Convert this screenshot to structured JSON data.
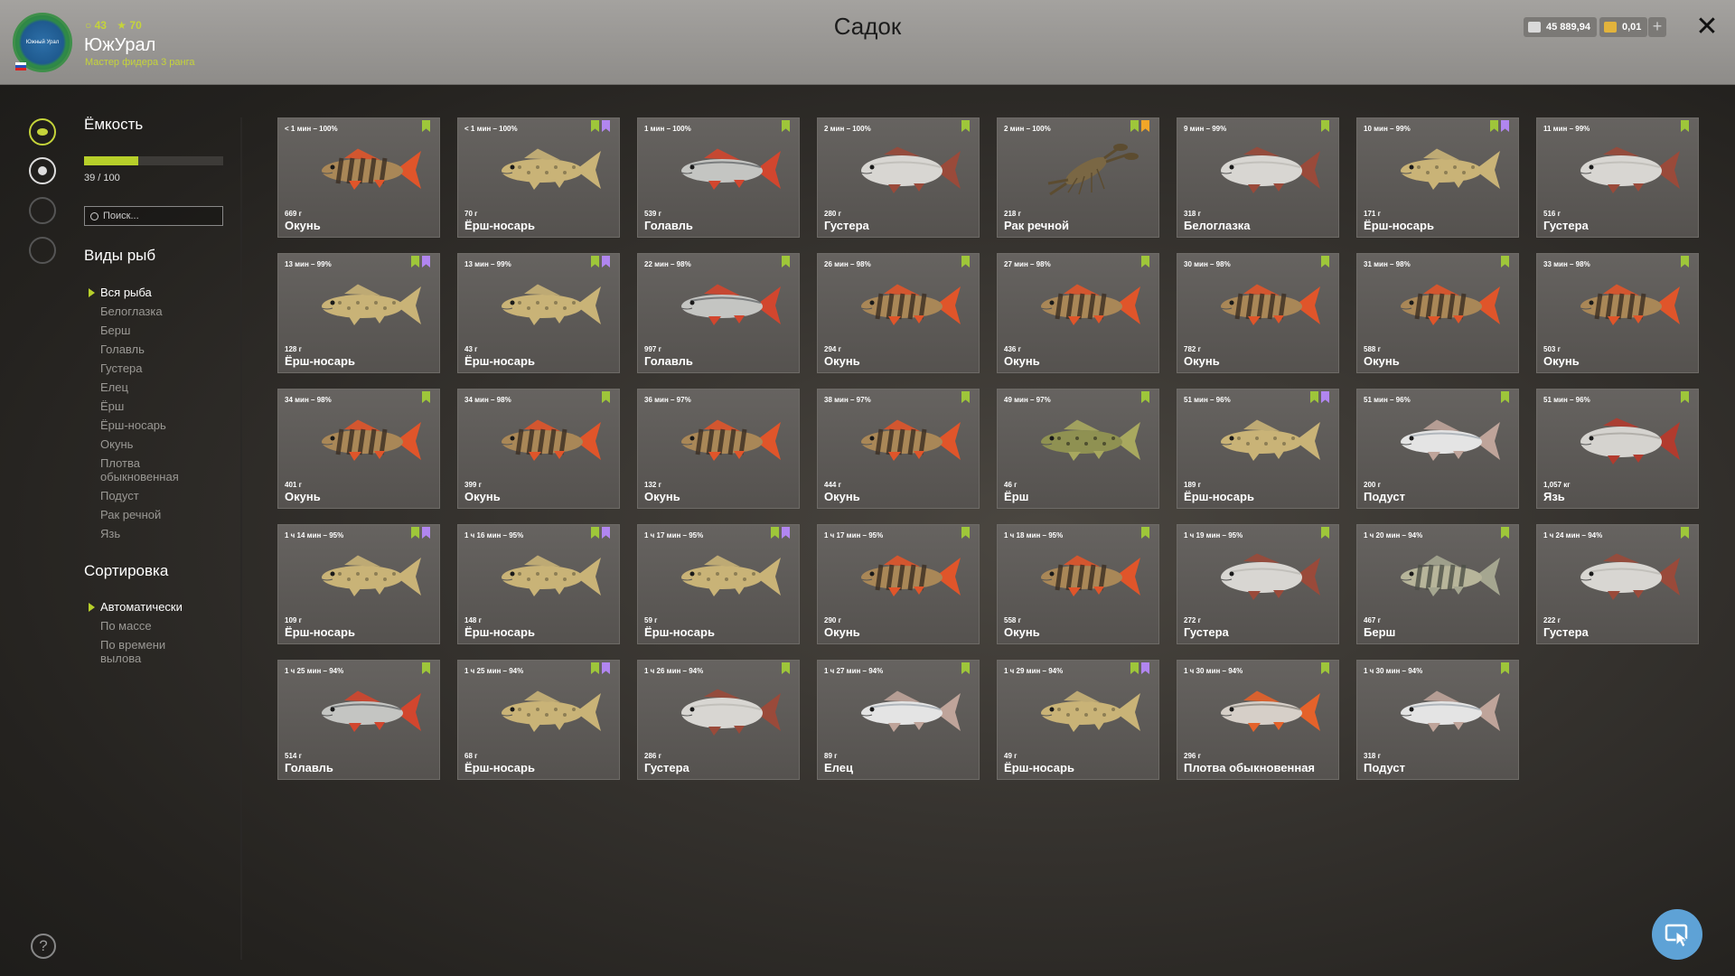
{
  "header": {
    "title": "Садок",
    "logo_text": "Южный Урал",
    "stats_a": "43",
    "stats_b": "70",
    "username": "ЮжУрал",
    "rank": "Мастер фидера 3 ранга",
    "silver": "45 889,94",
    "gold": "0,01",
    "plus": "+",
    "close": "✕"
  },
  "sidebar": {
    "capacity_title": "Ёмкость",
    "capacity_text": "39 / 100",
    "capacity_fraction": 0.39,
    "search_placeholder": "Поиск...",
    "species_title": "Виды рыб",
    "species": [
      "Вся рыба",
      "Белоглазка",
      "Берш",
      "Голавль",
      "Густера",
      "Елец",
      "Ёрш",
      "Ёрш-носарь",
      "Окунь",
      "Плотва обыкновенная",
      "Подуст",
      "Рак речной",
      "Язь"
    ],
    "species_selected": 0,
    "sort_title": "Сортировка",
    "sort": [
      "Автоматически",
      "По массе",
      "По времени вылова"
    ],
    "sort_selected": 0,
    "help": "?"
  },
  "catches": [
    {
      "time": "< 1 мин – 100%",
      "weight": "669 г",
      "name": "Окунь",
      "kind": "perch",
      "badges": [
        "green"
      ]
    },
    {
      "time": "< 1 мин – 100%",
      "weight": "70 г",
      "name": "Ёрш-носарь",
      "kind": "zander",
      "badges": [
        "green",
        "purple"
      ]
    },
    {
      "time": "1 мин – 100%",
      "weight": "539 г",
      "name": "Голавль",
      "kind": "chub",
      "badges": [
        "green"
      ]
    },
    {
      "time": "2 мин – 100%",
      "weight": "280 г",
      "name": "Густера",
      "kind": "bream",
      "badges": [
        "green"
      ]
    },
    {
      "time": "2 мин – 100%",
      "weight": "218 г",
      "name": "Рак речной",
      "kind": "crayfish",
      "badges": [
        "green",
        "orange"
      ]
    },
    {
      "time": "9 мин – 99%",
      "weight": "318 г",
      "name": "Белоглазка",
      "kind": "bream",
      "badges": [
        "green"
      ]
    },
    {
      "time": "10 мин – 99%",
      "weight": "171 г",
      "name": "Ёрш-носарь",
      "kind": "zander",
      "badges": [
        "green",
        "purple"
      ]
    },
    {
      "time": "11 мин – 99%",
      "weight": "516 г",
      "name": "Густера",
      "kind": "bream",
      "badges": [
        "green"
      ]
    },
    {
      "time": "13 мин – 99%",
      "weight": "128 г",
      "name": "Ёрш-носарь",
      "kind": "zander",
      "badges": [
        "green",
        "purple"
      ]
    },
    {
      "time": "13 мин – 99%",
      "weight": "43 г",
      "name": "Ёрш-носарь",
      "kind": "zander",
      "badges": [
        "green",
        "purple"
      ]
    },
    {
      "time": "22 мин – 98%",
      "weight": "997 г",
      "name": "Голавль",
      "kind": "chub",
      "badges": [
        "green"
      ]
    },
    {
      "time": "26 мин – 98%",
      "weight": "294 г",
      "name": "Окунь",
      "kind": "perch",
      "badges": [
        "green"
      ]
    },
    {
      "time": "27 мин – 98%",
      "weight": "436 г",
      "name": "Окунь",
      "kind": "perch",
      "badges": [
        "green"
      ]
    },
    {
      "time": "30 мин – 98%",
      "weight": "782 г",
      "name": "Окунь",
      "kind": "perch",
      "badges": [
        "green"
      ]
    },
    {
      "time": "31 мин – 98%",
      "weight": "588 г",
      "name": "Окунь",
      "kind": "perch",
      "badges": [
        "green"
      ]
    },
    {
      "time": "33 мин – 98%",
      "weight": "503 г",
      "name": "Окунь",
      "kind": "perch",
      "badges": [
        "green"
      ]
    },
    {
      "time": "34 мин – 98%",
      "weight": "401 г",
      "name": "Окунь",
      "kind": "perch",
      "badges": [
        "green"
      ]
    },
    {
      "time": "34 мин – 98%",
      "weight": "399 г",
      "name": "Окунь",
      "kind": "perch",
      "badges": [
        "green"
      ]
    },
    {
      "time": "36 мин – 97%",
      "weight": "132 г",
      "name": "Окунь",
      "kind": "perch",
      "badges": []
    },
    {
      "time": "38 мин – 97%",
      "weight": "444 г",
      "name": "Окунь",
      "kind": "perch",
      "badges": [
        "green"
      ]
    },
    {
      "time": "49 мин – 97%",
      "weight": "46 г",
      "name": "Ёрш",
      "kind": "ruffe",
      "badges": [
        "green"
      ]
    },
    {
      "time": "51 мин – 96%",
      "weight": "189 г",
      "name": "Ёрш-носарь",
      "kind": "zander",
      "badges": [
        "green",
        "purple"
      ]
    },
    {
      "time": "51 мин – 96%",
      "weight": "200 г",
      "name": "Подуст",
      "kind": "nase",
      "badges": [
        "green"
      ]
    },
    {
      "time": "51 мин – 96%",
      "weight": "1,057 кг",
      "name": "Язь",
      "kind": "ide",
      "badges": [
        "green"
      ]
    },
    {
      "time": "1 ч 14 мин – 95%",
      "weight": "109 г",
      "name": "Ёрш-носарь",
      "kind": "zander",
      "badges": [
        "green",
        "purple"
      ]
    },
    {
      "time": "1 ч 16 мин – 95%",
      "weight": "148 г",
      "name": "Ёрш-носарь",
      "kind": "zander",
      "badges": [
        "green",
        "purple"
      ]
    },
    {
      "time": "1 ч 17 мин – 95%",
      "weight": "59 г",
      "name": "Ёрш-носарь",
      "kind": "zander",
      "badges": [
        "green",
        "purple"
      ]
    },
    {
      "time": "1 ч 17 мин – 95%",
      "weight": "290 г",
      "name": "Окунь",
      "kind": "perch",
      "badges": [
        "green"
      ]
    },
    {
      "time": "1 ч 18 мин – 95%",
      "weight": "558 г",
      "name": "Окунь",
      "kind": "perch",
      "badges": [
        "green"
      ]
    },
    {
      "time": "1 ч 19 мин – 95%",
      "weight": "272 г",
      "name": "Густера",
      "kind": "bream",
      "badges": [
        "green"
      ]
    },
    {
      "time": "1 ч 20 мин – 94%",
      "weight": "467 г",
      "name": "Берш",
      "kind": "bersh",
      "badges": [
        "green"
      ]
    },
    {
      "time": "1 ч 24 мин – 94%",
      "weight": "222 г",
      "name": "Густера",
      "kind": "bream",
      "badges": [
        "green"
      ]
    },
    {
      "time": "1 ч 25 мин – 94%",
      "weight": "514 г",
      "name": "Голавль",
      "kind": "chub",
      "badges": [
        "green"
      ]
    },
    {
      "time": "1 ч 25 мин – 94%",
      "weight": "68 г",
      "name": "Ёрш-носарь",
      "kind": "zander",
      "badges": [
        "green",
        "purple"
      ]
    },
    {
      "time": "1 ч 26 мин – 94%",
      "weight": "286 г",
      "name": "Густера",
      "kind": "bream",
      "badges": [
        "green"
      ]
    },
    {
      "time": "1 ч 27 мин – 94%",
      "weight": "89 г",
      "name": "Елец",
      "kind": "nase",
      "badges": [
        "green"
      ]
    },
    {
      "time": "1 ч 29 мин – 94%",
      "weight": "49 г",
      "name": "Ёрш-носарь",
      "kind": "zander",
      "badges": [
        "green",
        "purple"
      ]
    },
    {
      "time": "1 ч 30 мин – 94%",
      "weight": "296 г",
      "name": "Плотва обыкновенная",
      "kind": "roach",
      "badges": [
        "green"
      ]
    },
    {
      "time": "1 ч 30 мин – 94%",
      "weight": "318 г",
      "name": "Подуст",
      "kind": "nase",
      "badges": [
        "green"
      ]
    }
  ],
  "fish_colors": {
    "perch": {
      "body": "#a98757",
      "stripe": "#3b2e22",
      "fin": "#e0552a"
    },
    "zander": {
      "body": "#c9b377",
      "stripe": "#8d7f55",
      "fin": "#c9b377"
    },
    "chub": {
      "body": "#c4c5c2",
      "stripe": "#5b5e61",
      "fin": "#d2462e"
    },
    "bream": {
      "body": "#d8d6d2",
      "stripe": "#b9b6b0",
      "fin": "#9a4a3a"
    },
    "crayfish": {
      "body": "#7a6744",
      "stripe": "#5c4c30",
      "fin": "#7a6744"
    },
    "ruffe": {
      "body": "#8f9152",
      "stripe": "#4f5030",
      "fin": "#a8a85f"
    },
    "nase": {
      "body": "#e4e4e4",
      "stripe": "#9aa3ab",
      "fin": "#bfa49a"
    },
    "ide": {
      "body": "#d5d3cf",
      "stripe": "#a3a09a",
      "fin": "#b23b2e"
    },
    "bersh": {
      "body": "#b7b59a",
      "stripe": "#4d5047",
      "fin": "#a5a690"
    },
    "roach": {
      "body": "#d6cfc8",
      "stripe": "#7f7a74",
      "fin": "#e5622a"
    }
  }
}
